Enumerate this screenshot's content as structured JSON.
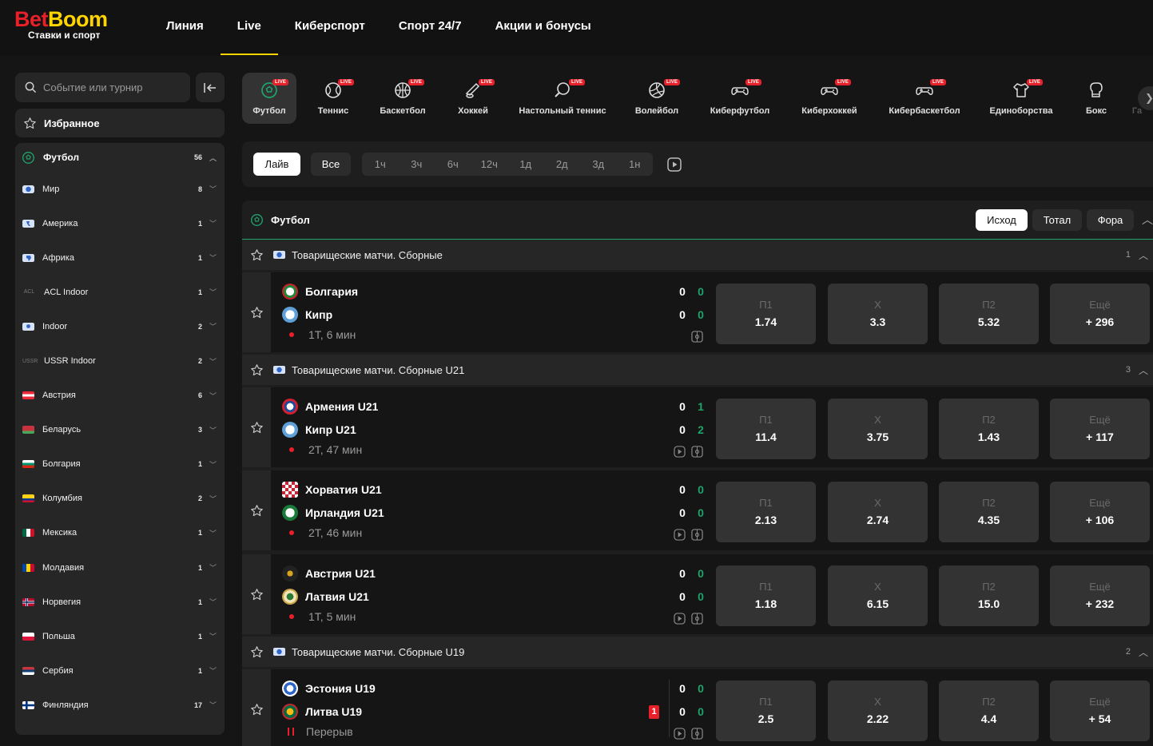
{
  "brand": {
    "name_part1": "Bet",
    "name_part2": "Boom",
    "tagline": "Ставки и спорт"
  },
  "nav": [
    {
      "label": "Линия",
      "active": false
    },
    {
      "label": "Live",
      "active": true
    },
    {
      "label": "Киберспорт",
      "active": false
    },
    {
      "label": "Спорт 24/7",
      "active": false
    },
    {
      "label": "Акции и бонусы",
      "active": false
    }
  ],
  "sidebar": {
    "search_placeholder": "Событие или турнир",
    "favorites_label": "Избранное",
    "sport": {
      "label": "Футбол",
      "count": "56"
    },
    "regions": [
      {
        "label": "Мир",
        "count": "8",
        "icon": "globe-icon"
      },
      {
        "label": "Америка",
        "count": "1",
        "icon": "americas-icon"
      },
      {
        "label": "Африка",
        "count": "1",
        "icon": "africa-icon"
      },
      {
        "label": "ACL Indoor",
        "count": "1",
        "icon": "acl-logo"
      },
      {
        "label": "Indoor",
        "count": "2",
        "icon": "location-icon"
      },
      {
        "label": "USSR Indoor",
        "count": "2",
        "icon": "ussr-logo"
      },
      {
        "label": "Австрия",
        "count": "6",
        "icon": "flag-austria"
      },
      {
        "label": "Беларусь",
        "count": "3",
        "icon": "flag-belarus"
      },
      {
        "label": "Болгария",
        "count": "1",
        "icon": "flag-bulgaria"
      },
      {
        "label": "Колумбия",
        "count": "2",
        "icon": "flag-colombia"
      },
      {
        "label": "Мексика",
        "count": "1",
        "icon": "flag-mexico"
      },
      {
        "label": "Молдавия",
        "count": "1",
        "icon": "flag-moldova"
      },
      {
        "label": "Норвегия",
        "count": "1",
        "icon": "flag-norway"
      },
      {
        "label": "Польша",
        "count": "1",
        "icon": "flag-poland"
      },
      {
        "label": "Сербия",
        "count": "1",
        "icon": "flag-serbia"
      },
      {
        "label": "Финляндия",
        "count": "17",
        "icon": "flag-finland"
      }
    ]
  },
  "sport_tabs": [
    {
      "label": "Футбол",
      "badge": "LIVE",
      "icon": "soccer-ball-icon",
      "active": true
    },
    {
      "label": "Теннис",
      "badge": "LIVE",
      "icon": "tennis-ball-icon"
    },
    {
      "label": "Баскетбол",
      "badge": "LIVE",
      "icon": "basketball-icon"
    },
    {
      "label": "Хоккей",
      "badge": "LIVE",
      "icon": "hockey-puck-icon"
    },
    {
      "label": "Настольный теннис",
      "badge": "LIVE",
      "icon": "table-tennis-icon"
    },
    {
      "label": "Волейбол",
      "badge": "LIVE",
      "icon": "volleyball-icon"
    },
    {
      "label": "Киберфутбол",
      "badge": "LIVE",
      "icon": "gamepad-icon"
    },
    {
      "label": "Киберхоккей",
      "badge": "LIVE",
      "icon": "gamepad-icon"
    },
    {
      "label": "Кибербаскетбол",
      "badge": "LIVE",
      "icon": "gamepad-icon"
    },
    {
      "label": "Единоборства",
      "badge": "LIVE",
      "icon": "fight-shirt-icon"
    },
    {
      "label": "Бокс",
      "badge": "",
      "icon": "boxing-glove-icon"
    },
    {
      "label": "Га",
      "badge": "",
      "icon": ""
    }
  ],
  "filters": {
    "live_label": "Лайв",
    "all_label": "Все",
    "periods": [
      "1ч",
      "3ч",
      "6ч",
      "12ч",
      "1д",
      "2д",
      "3д",
      "1н"
    ]
  },
  "events": {
    "title": "Футбол",
    "markets": [
      "Исход",
      "Тотал",
      "Фора"
    ],
    "active_market": "Исход",
    "odds_labels": [
      "П1",
      "Х",
      "П2",
      "Ещё"
    ],
    "leagues": [
      {
        "name": "Товарищеские матчи. Сборные",
        "count": "1",
        "matches": [
          {
            "home": "Болгария",
            "away": "Кипр",
            "home_score": "0",
            "home_score2": "0",
            "away_score": "0",
            "away_score2": "0",
            "time": "1Т, 6 мин",
            "odds": [
              "1.74",
              "3.3",
              "5.32",
              "+ 296"
            ]
          }
        ]
      },
      {
        "name": "Товарищеские матчи. Сборные U21",
        "count": "3",
        "matches": [
          {
            "home": "Армения U21",
            "away": "Кипр U21",
            "home_score": "0",
            "home_score2": "1",
            "away_score": "0",
            "away_score2": "2",
            "time": "2Т, 47 мин",
            "odds": [
              "11.4",
              "3.75",
              "1.43",
              "+ 117"
            ]
          },
          {
            "home": "Хорватия U21",
            "away": "Ирландия U21",
            "home_score": "0",
            "home_score2": "0",
            "away_score": "0",
            "away_score2": "0",
            "time": "2Т, 46 мин",
            "odds": [
              "2.13",
              "2.74",
              "4.35",
              "+ 106"
            ]
          },
          {
            "home": "Австрия U21",
            "away": "Латвия U21",
            "home_score": "0",
            "home_score2": "0",
            "away_score": "0",
            "away_score2": "0",
            "time": "1Т, 5 мин",
            "odds": [
              "1.18",
              "6.15",
              "15.0",
              "+ 232"
            ]
          }
        ]
      },
      {
        "name": "Товарищеские матчи. Сборные U19",
        "count": "2",
        "matches": [
          {
            "home": "Эстония U19",
            "away": "Литва U19",
            "home_score": "0",
            "home_score2": "0",
            "away_score": "0",
            "away_score2": "0",
            "time": "Перерыв",
            "red_cards": "1",
            "odds": [
              "2.5",
              "2.22",
              "4.4",
              "+ 54"
            ]
          }
        ]
      }
    ]
  },
  "colors": {
    "accent": "#ffd400",
    "brand_red": "#e8202a",
    "green": "#1fa36b",
    "panel": "#262626",
    "bg": "#151515"
  }
}
